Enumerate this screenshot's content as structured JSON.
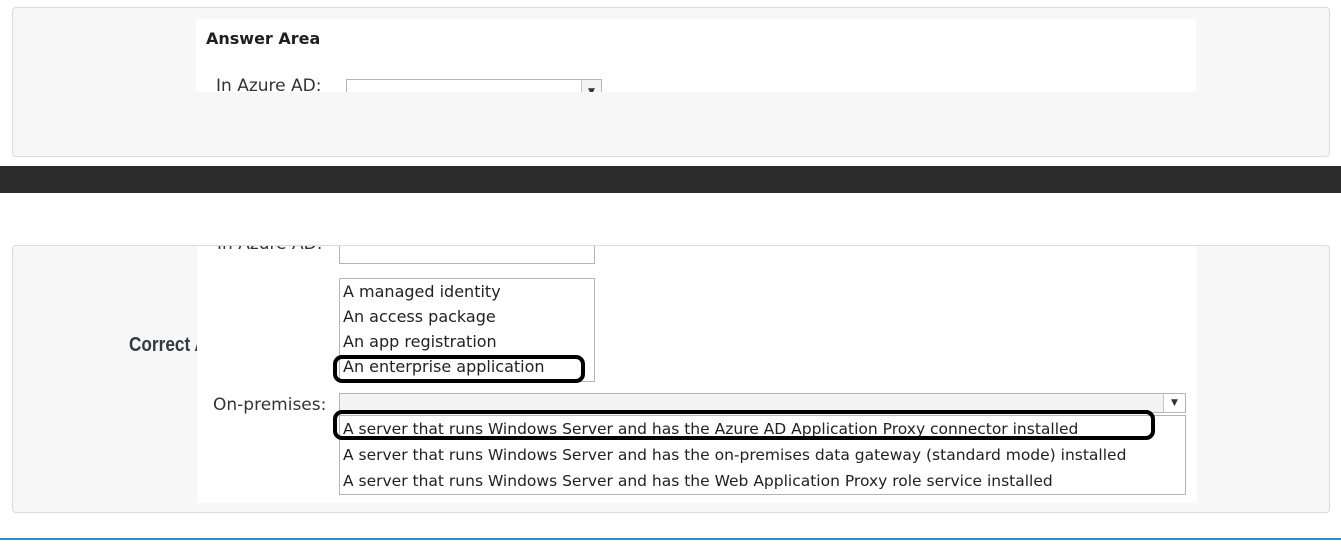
{
  "top_card": {
    "title": "Answer Area",
    "azure_label": "In Azure AD:"
  },
  "bottom_card": {
    "correct_answer_label": "Correct Answer:",
    "azure_label": "In Azure AD:",
    "azure_options": [
      "A managed identity",
      "An access package",
      "An app registration",
      "An enterprise application"
    ],
    "azure_selected_index": 3,
    "onprem_label": "On-premises:",
    "onprem_options": [
      "A server that runs Windows Server and has the Azure AD Application Proxy connector installed",
      "A server that runs Windows Server and has the on-premises data gateway (standard mode) installed",
      "A server that runs Windows Server and has the Web Application Proxy role service installed"
    ],
    "onprem_selected_index": 0
  },
  "icons": {
    "dropdown_arrow": "chevron-down-icon"
  },
  "colors": {
    "dark_bar": "#2b2b2b",
    "accent_line": "#2d8ccd",
    "card_bg": "#f7f7f7"
  }
}
